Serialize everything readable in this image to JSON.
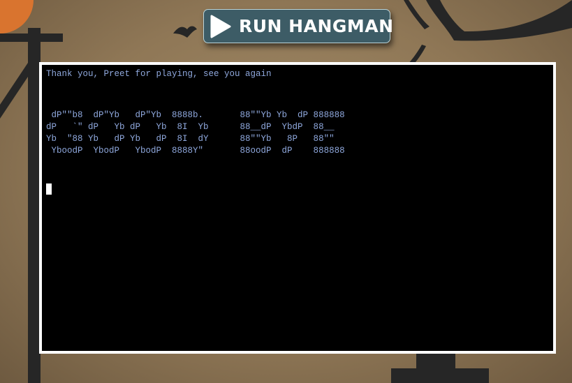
{
  "header": {
    "run_button_label": "RUN HANGMAN",
    "run_button_icon": "play-icon"
  },
  "terminal": {
    "message": "Thank you, Preet for playing, see you again",
    "banner_lines": [
      " dP\"\"b8  dP\"Yb   dP\"Yb  8888b.       88\"\"Yb Yb  dP 888888",
      "dP   `\" dP   Yb dP   Yb  8I  Yb      88__dP  YbdP  88__",
      "Yb  \"88 Yb   dP Yb   dP  8I  dY      88\"\"Yb   8P   88\"\"",
      " YboodP  YbodP   YbodP  8888Y\"       88oodP  dP    888888"
    ]
  },
  "colors": {
    "terminal_text": "#8fa8dd",
    "button_bg": "#3d5c66",
    "page_bg": "#98805e"
  }
}
